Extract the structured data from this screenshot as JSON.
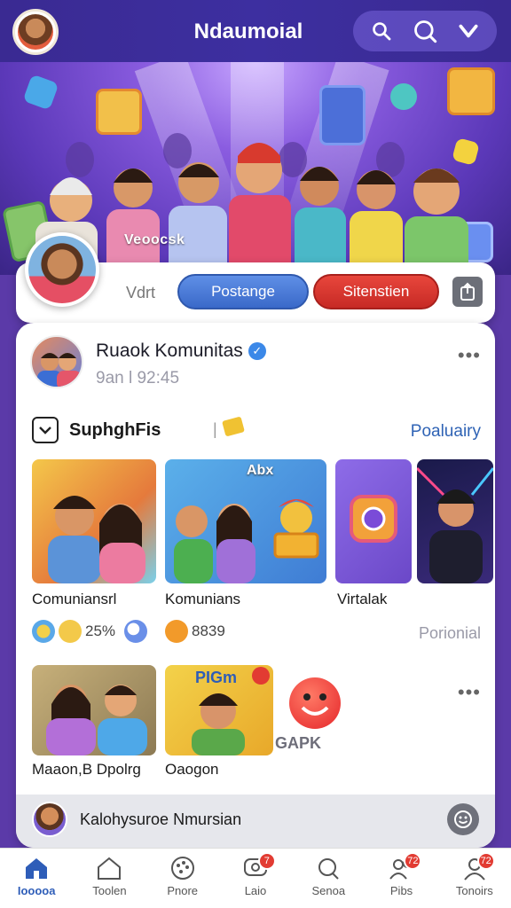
{
  "app": {
    "title": "Ndaumoial"
  },
  "colors": {
    "accent": "#3a69c9",
    "danger": "#c72a25",
    "header": "#3a2a92",
    "link": "#2f63b5"
  },
  "header": {
    "icons": [
      "search-icon",
      "search-icon",
      "chevron-down-icon"
    ]
  },
  "hero": {
    "tag": "Veoocsk"
  },
  "profile": {
    "visit_label": "Vdrt",
    "primary_button": "Postange",
    "secondary_button": "Sitenstien"
  },
  "post": {
    "title": "Ruaok Komunitas",
    "time": "9an l 92:45",
    "filter_label": "SuphghFis",
    "filter_sep": "|",
    "popularity_label": "Poaluairy",
    "cards": [
      {
        "label": "Comuniansrl"
      },
      {
        "label": "Komunians",
        "overlay": "Abx"
      },
      {
        "label": "Virtalak"
      }
    ],
    "stats": [
      {
        "text": "25%"
      },
      {
        "text": "8839"
      }
    ],
    "pop_side_label": "Porionial",
    "cards2": [
      {
        "label": "Maaon,B Dpolrg"
      },
      {
        "label": "Oaogon",
        "overlay": "PIGm"
      },
      {
        "label": "GAPK"
      }
    ],
    "comment_placeholder": "Kalohysuroe Nmursian"
  },
  "nav": {
    "items": [
      {
        "label": "Iooooa",
        "icon": "home-icon",
        "badge": ""
      },
      {
        "label": "Toolen",
        "icon": "house-outline-icon",
        "badge": ""
      },
      {
        "label": "Pnore",
        "icon": "palette-icon",
        "badge": ""
      },
      {
        "label": "Laio",
        "icon": "chat-icon",
        "badge": "7"
      },
      {
        "label": "Senoa",
        "icon": "search-icon",
        "badge": ""
      },
      {
        "label": "Pibs",
        "icon": "friends-icon",
        "badge": "72"
      },
      {
        "label": "Tonoirs",
        "icon": "profile-icon",
        "badge": "72"
      }
    ]
  }
}
